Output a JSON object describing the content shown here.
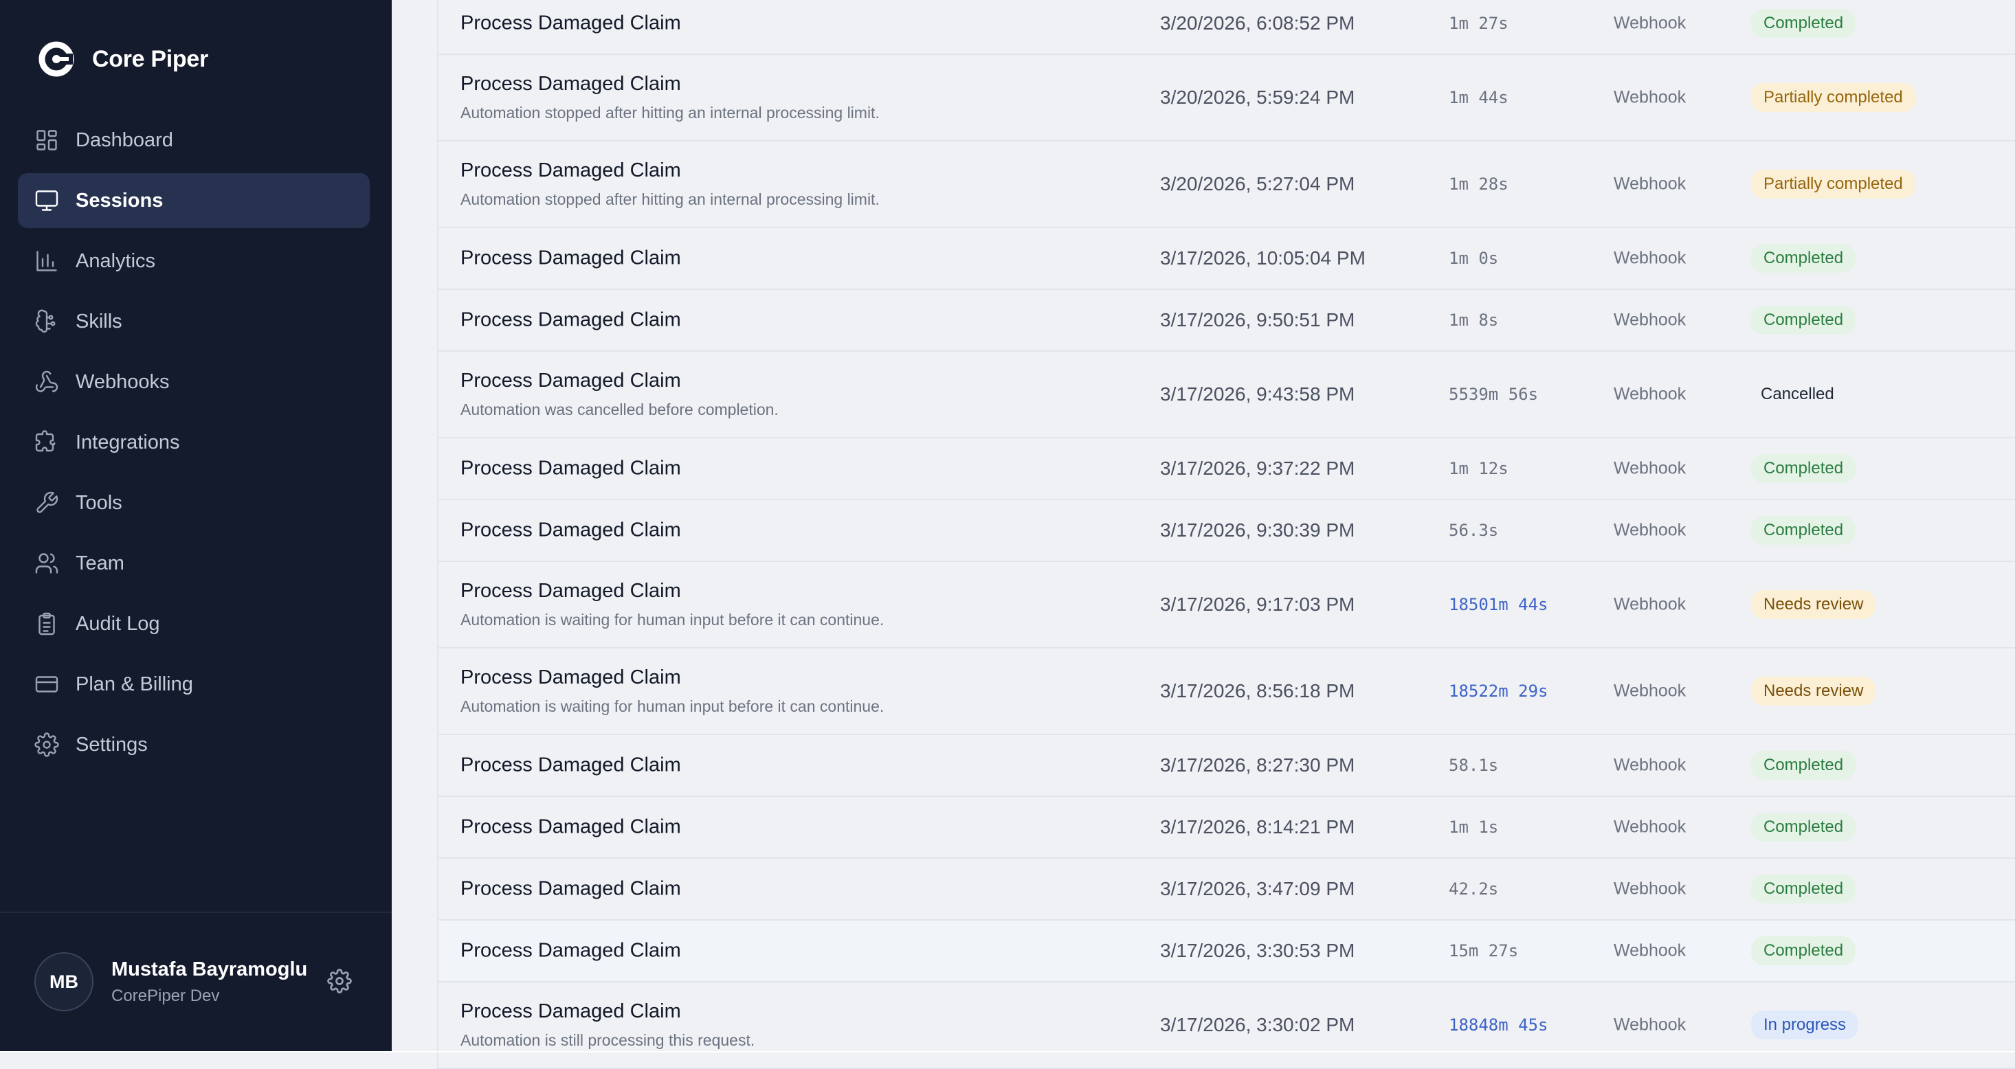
{
  "brand": {
    "name": "Core Piper"
  },
  "nav": [
    {
      "label": "Dashboard",
      "icon": "dashboard-icon",
      "active": false
    },
    {
      "label": "Sessions",
      "icon": "monitor-icon",
      "active": true
    },
    {
      "label": "Analytics",
      "icon": "bar-chart-icon",
      "active": false
    },
    {
      "label": "Skills",
      "icon": "brain-icon",
      "active": false
    },
    {
      "label": "Webhooks",
      "icon": "webhook-icon",
      "active": false
    },
    {
      "label": "Integrations",
      "icon": "puzzle-icon",
      "active": false
    },
    {
      "label": "Tools",
      "icon": "wrench-icon",
      "active": false
    },
    {
      "label": "Team",
      "icon": "users-icon",
      "active": false
    },
    {
      "label": "Audit Log",
      "icon": "clipboard-icon",
      "active": false
    },
    {
      "label": "Plan & Billing",
      "icon": "credit-card-icon",
      "active": false
    },
    {
      "label": "Settings",
      "icon": "gear-icon",
      "active": false
    }
  ],
  "user": {
    "initials": "MB",
    "name": "Mustafa Bayramoglu",
    "org": "CorePiper Dev"
  },
  "sessions": [
    {
      "name": "Process Damaged Claim",
      "desc": "",
      "date": "3/20/2026, 6:08:52 PM",
      "duration": "1m 27s",
      "source": "Webhook",
      "status": "Completed",
      "status_kind": "completed",
      "highlight_duration": false
    },
    {
      "name": "Process Damaged Claim",
      "desc": "Automation stopped after hitting an internal processing limit.",
      "date": "3/20/2026, 5:59:24 PM",
      "duration": "1m 44s",
      "source": "Webhook",
      "status": "Partially completed",
      "status_kind": "partial",
      "highlight_duration": false
    },
    {
      "name": "Process Damaged Claim",
      "desc": "Automation stopped after hitting an internal processing limit.",
      "date": "3/20/2026, 5:27:04 PM",
      "duration": "1m 28s",
      "source": "Webhook",
      "status": "Partially completed",
      "status_kind": "partial",
      "highlight_duration": false
    },
    {
      "name": "Process Damaged Claim",
      "desc": "",
      "date": "3/17/2026, 10:05:04 PM",
      "duration": "1m 0s",
      "source": "Webhook",
      "status": "Completed",
      "status_kind": "completed",
      "highlight_duration": false
    },
    {
      "name": "Process Damaged Claim",
      "desc": "",
      "date": "3/17/2026, 9:50:51 PM",
      "duration": "1m 8s",
      "source": "Webhook",
      "status": "Completed",
      "status_kind": "completed",
      "highlight_duration": false
    },
    {
      "name": "Process Damaged Claim",
      "desc": "Automation was cancelled before completion.",
      "date": "3/17/2026, 9:43:58 PM",
      "duration": "5539m 56s",
      "source": "Webhook",
      "status": "Cancelled",
      "status_kind": "cancelled",
      "highlight_duration": false
    },
    {
      "name": "Process Damaged Claim",
      "desc": "",
      "date": "3/17/2026, 9:37:22 PM",
      "duration": "1m 12s",
      "source": "Webhook",
      "status": "Completed",
      "status_kind": "completed",
      "highlight_duration": false
    },
    {
      "name": "Process Damaged Claim",
      "desc": "",
      "date": "3/17/2026, 9:30:39 PM",
      "duration": "56.3s",
      "source": "Webhook",
      "status": "Completed",
      "status_kind": "completed",
      "highlight_duration": false
    },
    {
      "name": "Process Damaged Claim",
      "desc": "Automation is waiting for human input before it can continue.",
      "date": "3/17/2026, 9:17:03 PM",
      "duration": "18501m 44s",
      "source": "Webhook",
      "status": "Needs review",
      "status_kind": "review",
      "highlight_duration": true
    },
    {
      "name": "Process Damaged Claim",
      "desc": "Automation is waiting for human input before it can continue.",
      "date": "3/17/2026, 8:56:18 PM",
      "duration": "18522m 29s",
      "source": "Webhook",
      "status": "Needs review",
      "status_kind": "review",
      "highlight_duration": true
    },
    {
      "name": "Process Damaged Claim",
      "desc": "",
      "date": "3/17/2026, 8:27:30 PM",
      "duration": "58.1s",
      "source": "Webhook",
      "status": "Completed",
      "status_kind": "completed",
      "highlight_duration": false
    },
    {
      "name": "Process Damaged Claim",
      "desc": "",
      "date": "3/17/2026, 8:14:21 PM",
      "duration": "1m 1s",
      "source": "Webhook",
      "status": "Completed",
      "status_kind": "completed",
      "highlight_duration": false
    },
    {
      "name": "Process Damaged Claim",
      "desc": "",
      "date": "3/17/2026, 3:47:09 PM",
      "duration": "42.2s",
      "source": "Webhook",
      "status": "Completed",
      "status_kind": "completed",
      "highlight_duration": false
    },
    {
      "name": "Process Damaged Claim",
      "desc": "",
      "date": "3/17/2026, 3:30:53 PM",
      "duration": "15m 27s",
      "source": "Webhook",
      "status": "Completed",
      "status_kind": "completed",
      "highlight_duration": false,
      "hovered": true
    },
    {
      "name": "Process Damaged Claim",
      "desc": "Automation is still processing this request.",
      "date": "3/17/2026, 3:30:02 PM",
      "duration": "18848m 45s",
      "source": "Webhook",
      "status": "In progress",
      "status_kind": "progress",
      "highlight_duration": true
    }
  ]
}
